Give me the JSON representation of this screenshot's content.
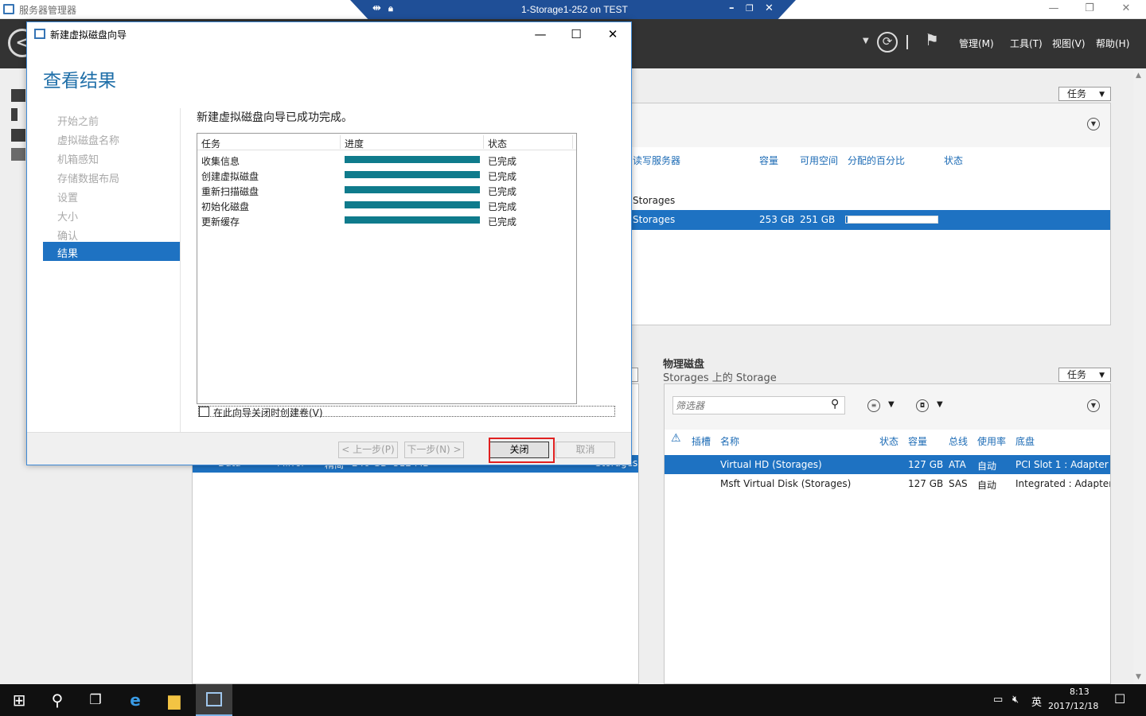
{
  "sm_window": {
    "title": "服务器管理器",
    "rdp_title": "1-Storage1-252 on TEST"
  },
  "sm_header": {
    "menus": [
      "管理(M)",
      "工具(T)",
      "视图(V)",
      "帮助(H)"
    ]
  },
  "tasks_label": "任务",
  "top_panel": {
    "columns": [
      "读写服务器",
      "容量",
      "可用空间",
      "分配的百分比",
      "状态"
    ],
    "group_label": "Storages",
    "selected_row": {
      "name": "Storages",
      "capacity": "253 GB",
      "free": "251 GB",
      "allocated_percent": 2
    }
  },
  "bottom_left_row": {
    "cells": [
      "Data",
      "Mirror",
      "精简",
      "240 GB",
      "512 MB",
      "Storages"
    ]
  },
  "physical_disks": {
    "title": "物理磁盘",
    "subtitle": "Storages 上的 Storage",
    "filter_placeholder": "筛选器",
    "columns": [
      "插槽",
      "名称",
      "状态",
      "容量",
      "总线",
      "使用率",
      "底盘"
    ],
    "rows": [
      {
        "name": "Virtual HD (Storages)",
        "capacity": "127 GB",
        "bus": "ATA",
        "usage": "自动",
        "chassis": "PCI Slot 1 : Adapter 0"
      },
      {
        "name": "Msft Virtual Disk (Storages)",
        "capacity": "127 GB",
        "bus": "SAS",
        "usage": "自动",
        "chassis": "Integrated : Adapter"
      }
    ]
  },
  "dialog": {
    "title": "新建虚拟磁盘向导",
    "heading": "查看结果",
    "steps": [
      "开始之前",
      "虚拟磁盘名称",
      "机箱感知",
      "存储数据布局",
      "设置",
      "大小",
      "确认",
      "结果"
    ],
    "active_step": "结果",
    "message": "新建虚拟磁盘向导已成功完成。",
    "table_headers": [
      "任务",
      "进度",
      "状态"
    ],
    "tasks": [
      {
        "name": "收集信息",
        "progress": 100,
        "status": "已完成"
      },
      {
        "name": "创建虚拟磁盘",
        "progress": 100,
        "status": "已完成"
      },
      {
        "name": "重新扫描磁盘",
        "progress": 100,
        "status": "已完成"
      },
      {
        "name": "初始化磁盘",
        "progress": 100,
        "status": "已完成"
      },
      {
        "name": "更新缓存",
        "progress": 100,
        "status": "已完成"
      }
    ],
    "checkbox_label": "在此向导关闭时创建卷(V)",
    "buttons": {
      "prev": "< 上一步(P)",
      "next": "下一步(N) >",
      "close": "关闭",
      "cancel": "取消"
    }
  },
  "tray": {
    "ime": "英",
    "time": "8:13",
    "date": "2017/12/18"
  },
  "colors": {
    "accent": "#1e72c2",
    "progress": "#0f7b8c",
    "header_bg": "#333333",
    "highlight": "#e02020"
  }
}
